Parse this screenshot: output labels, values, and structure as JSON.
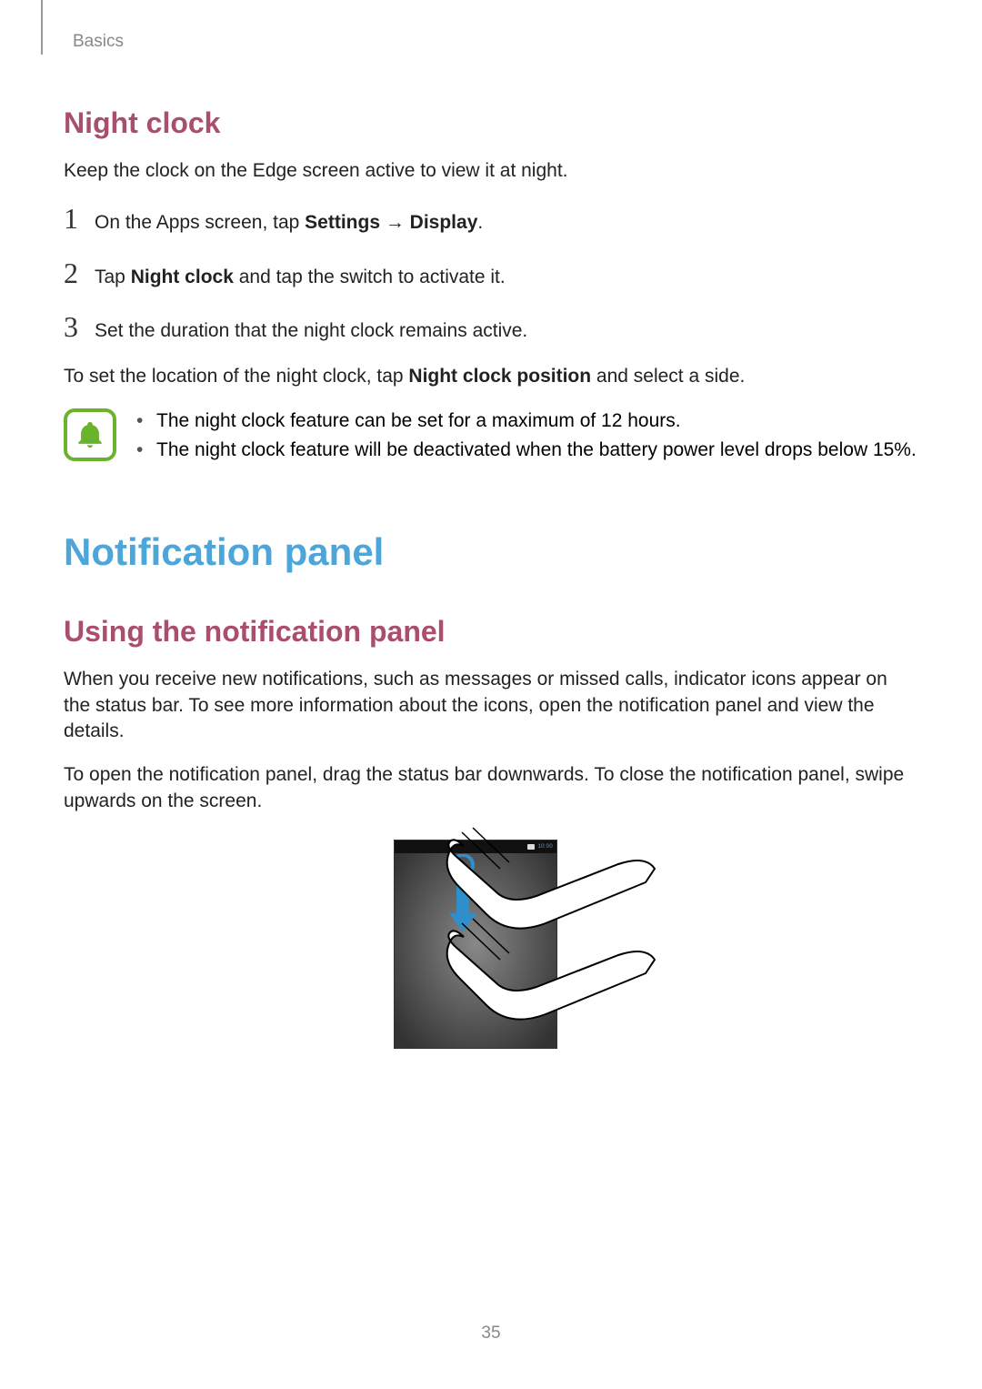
{
  "header": {
    "section": "Basics"
  },
  "section1": {
    "heading": "Night clock",
    "intro": "Keep the clock on the Edge screen active to view it at night.",
    "steps": {
      "s1": {
        "num": "1",
        "prefix": "On the Apps screen, tap ",
        "bold1": "Settings",
        "arrow": " → ",
        "bold2": "Display",
        "suffix": "."
      },
      "s2": {
        "num": "2",
        "prefix": "Tap ",
        "bold1": "Night clock",
        "suffix": " and tap the switch to activate it."
      },
      "s3": {
        "num": "3",
        "text": "Set the duration that the night clock remains active."
      }
    },
    "after_steps": {
      "prefix": "To set the location of the night clock, tap ",
      "bold": "Night clock position",
      "suffix": " and select a side."
    },
    "notes": {
      "n1": "The night clock feature can be set for a maximum of 12 hours.",
      "n2": "The night clock feature will be deactivated when the battery power level drops below 15%."
    }
  },
  "section2": {
    "heading": "Notification panel",
    "subheading": "Using the notification panel",
    "p1": "When you receive new notifications, such as messages or missed calls, indicator icons appear on the status bar. To see more information about the icons, open the notification panel and view the details.",
    "p2": "To open the notification panel, drag the status bar downwards. To close the notification panel, swipe upwards on the screen."
  },
  "illustration": {
    "time": "10:00"
  },
  "page_number": "35"
}
